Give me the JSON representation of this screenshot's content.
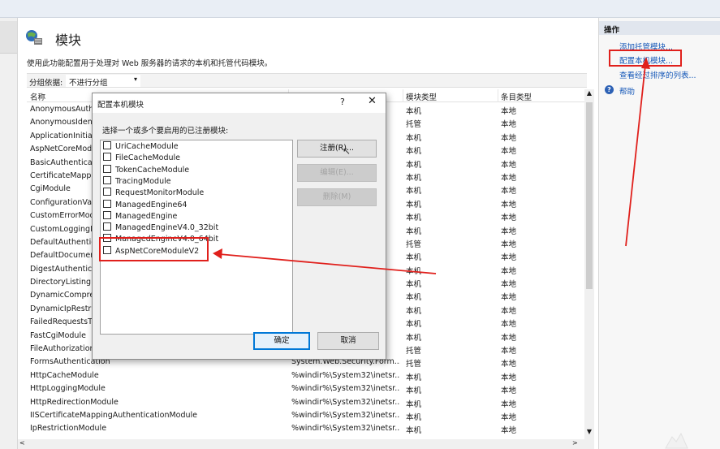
{
  "main": {
    "title": "模块",
    "description": "使用此功能配置用于处理对 Web 服务器的请求的本机和托管代码模块。",
    "group_by_label": "分组依据:",
    "group_by_value": "不进行分组",
    "columns": {
      "name": "名称",
      "code": "",
      "type": "模块类型",
      "entry": "条目类型"
    },
    "rows": [
      {
        "name": "AnonymousAuthenticationModule",
        "code": "",
        "type": "本机",
        "entry": "本地"
      },
      {
        "name": "AnonymousIdentification",
        "code": "",
        "type": "托管",
        "entry": "本地"
      },
      {
        "name": "ApplicationInitializationModule",
        "code": "",
        "type": "本机",
        "entry": "本地"
      },
      {
        "name": "AspNetCoreModuleV2",
        "code": "",
        "type": "本机",
        "entry": "本地"
      },
      {
        "name": "BasicAuthenticationModule",
        "code": "",
        "type": "本机",
        "entry": "本地"
      },
      {
        "name": "CertificateMappingAuthenticationModule",
        "code": "",
        "type": "本机",
        "entry": "本地"
      },
      {
        "name": "CgiModule",
        "code": "",
        "type": "本机",
        "entry": "本地"
      },
      {
        "name": "ConfigurationValidationModule",
        "code": "",
        "type": "本机",
        "entry": "本地"
      },
      {
        "name": "CustomErrorModule",
        "code": "",
        "type": "本机",
        "entry": "本地"
      },
      {
        "name": "CustomLoggingModule",
        "code": "",
        "type": "本机",
        "entry": "本地"
      },
      {
        "name": "DefaultAuthentication",
        "code": "",
        "type": "托管",
        "entry": "本地"
      },
      {
        "name": "DefaultDocumentModule",
        "code": "",
        "type": "本机",
        "entry": "本地"
      },
      {
        "name": "DigestAuthenticationModule",
        "code": "",
        "type": "本机",
        "entry": "本地"
      },
      {
        "name": "DirectoryListingModule",
        "code": "",
        "type": "本机",
        "entry": "本地"
      },
      {
        "name": "DynamicCompressionModule",
        "code": "",
        "type": "本机",
        "entry": "本地"
      },
      {
        "name": "DynamicIpRestrictionModule",
        "code": "",
        "type": "本机",
        "entry": "本地"
      },
      {
        "name": "FailedRequestsTracingModule",
        "code": "",
        "type": "本机",
        "entry": "本地"
      },
      {
        "name": "FastCgiModule",
        "code": "",
        "type": "本机",
        "entry": "本地"
      },
      {
        "name": "FileAuthorization",
        "code": "",
        "type": "托管",
        "entry": "本地"
      },
      {
        "name": "FormsAuthentication",
        "code": "System.Web.Security.Form...",
        "type": "托管",
        "entry": "本地"
      },
      {
        "name": "HttpCacheModule",
        "code": "%windir%\\System32\\inetsr...",
        "type": "本机",
        "entry": "本地"
      },
      {
        "name": "HttpLoggingModule",
        "code": "%windir%\\System32\\inetsr...",
        "type": "本机",
        "entry": "本地"
      },
      {
        "name": "HttpRedirectionModule",
        "code": "%windir%\\System32\\inetsr...",
        "type": "本机",
        "entry": "本地"
      },
      {
        "name": "IISCertificateMappingAuthenticationModule",
        "code": "%windir%\\System32\\inetsr...",
        "type": "本机",
        "entry": "本地"
      },
      {
        "name": "IpRestrictionModule",
        "code": "%windir%\\System32\\inetsr...",
        "type": "本机",
        "entry": "本地"
      }
    ]
  },
  "actions": {
    "header": "操作",
    "links": [
      "添加托管模块...",
      "配置本机模块...",
      "查看经过排序的列表..."
    ],
    "help": "帮助",
    "help_icon": "?"
  },
  "dialog": {
    "title": "配置本机模块",
    "help_glyph": "?",
    "close_glyph": "✕",
    "prompt": "选择一个或多个要启用的已注册模块:",
    "modules": [
      "UriCacheModule",
      "FileCacheModule",
      "TokenCacheModule",
      "TracingModule",
      "RequestMonitorModule",
      "ManagedEngine64",
      "ManagedEngine",
      "ManagedEngineV4.0_32bit",
      "ManagedEngineV4.0_64bit",
      "AspNetCoreModuleV2"
    ],
    "register_button": "注册(R)...",
    "edit_button": "编辑(E)...",
    "delete_button": "删除(M)",
    "ok_button": "确定",
    "cancel_button": "取消"
  },
  "ui": {
    "dropdown_arrow": "▾",
    "scroll_up": "▲",
    "scroll_down": "▼",
    "scroll_left": "<",
    "scroll_right": ">",
    "cursor_glyph": "↖"
  },
  "colors": {
    "annotation": "#e0201c",
    "link": "#1457b8",
    "primary_border": "#0078d7"
  }
}
